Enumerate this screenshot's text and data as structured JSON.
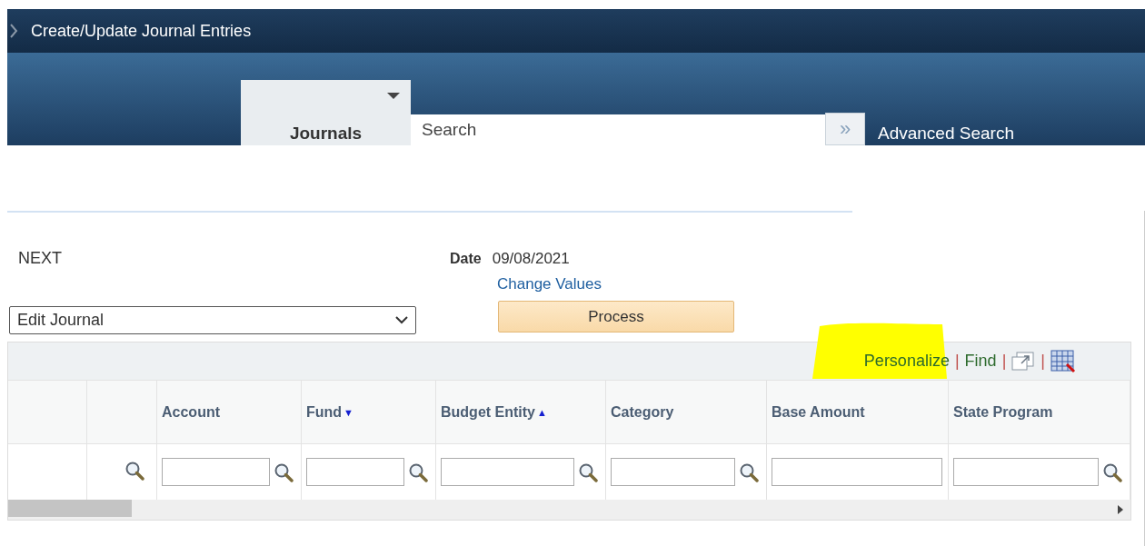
{
  "header": {
    "title": "Create/Update Journal Entries"
  },
  "navbar": {
    "tab": {
      "label": "Journals"
    },
    "search": {
      "placeholder": "Search"
    },
    "search_button": "»",
    "advanced_search": "Advanced Search"
  },
  "form": {
    "next_label": "NEXT",
    "date_label": "Date",
    "date_value": "09/08/2021",
    "change_values": "Change Values",
    "action": {
      "value": "Edit Journal"
    },
    "process_button": "Process"
  },
  "grid": {
    "toolbar": [
      {
        "kind": "link",
        "label": "Personalize",
        "highlighted": true
      },
      {
        "kind": "separator",
        "label": "|"
      },
      {
        "kind": "link",
        "label": "Find",
        "highlighted": false
      },
      {
        "kind": "separator",
        "label": "|"
      },
      {
        "kind": "zoom"
      },
      {
        "kind": "separator",
        "label": "|"
      },
      {
        "kind": "download"
      }
    ],
    "columns": [
      {
        "kind": "blank"
      },
      {
        "kind": "blank"
      },
      {
        "label": "Account",
        "kind": "lookup"
      },
      {
        "label": "Fund",
        "kind": "lookup",
        "sort_icon": "▼"
      },
      {
        "label": "Budget Entity",
        "kind": "lookup",
        "sort_icon": "▲"
      },
      {
        "label": "Category",
        "kind": "lookup"
      },
      {
        "label": "Base Amount",
        "kind": "field"
      },
      {
        "label": "State Program",
        "kind": "lookup"
      }
    ]
  }
}
